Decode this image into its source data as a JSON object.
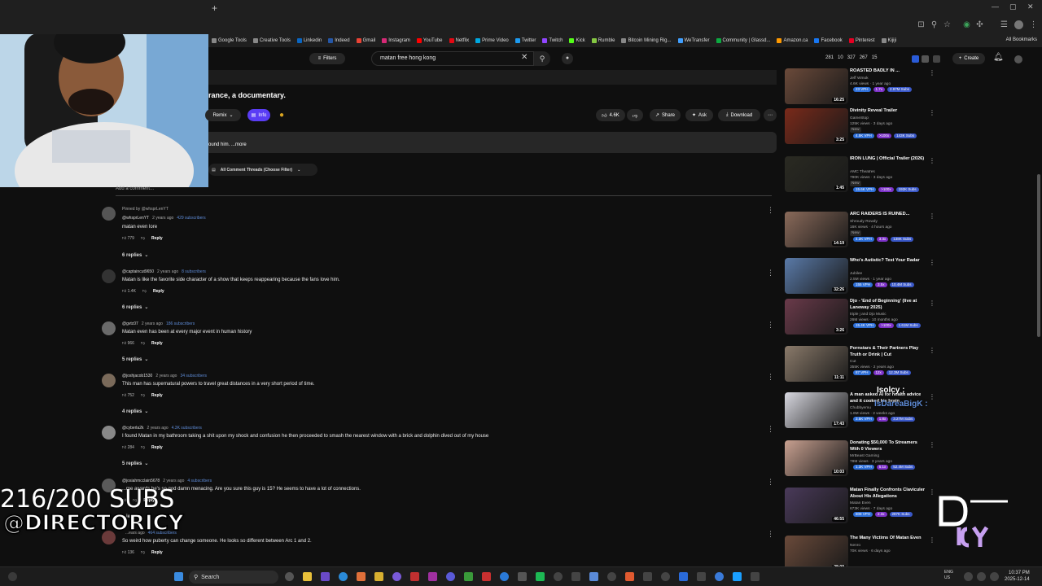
{
  "browser": {
    "new_tab": "+",
    "bookmarks": [
      {
        "label": "Google Tools",
        "color": "#888888"
      },
      {
        "label": "Creative Tools",
        "color": "#888888"
      },
      {
        "label": "Linkedin",
        "color": "#0a66c2"
      },
      {
        "label": "Indeed",
        "color": "#2557a7"
      },
      {
        "label": "Gmail",
        "color": "#ea4335"
      },
      {
        "label": "Instagram",
        "color": "#d62976"
      },
      {
        "label": "YouTube",
        "color": "#ff0000"
      },
      {
        "label": "Netflix",
        "color": "#e50914"
      },
      {
        "label": "Prime Video",
        "color": "#00a8e1"
      },
      {
        "label": "Twitter",
        "color": "#1d9bf0"
      },
      {
        "label": "Twitch",
        "color": "#9146ff"
      },
      {
        "label": "Kick",
        "color": "#53fc18"
      },
      {
        "label": "Rumble",
        "color": "#85c742"
      },
      {
        "label": "Bitcoin Mining Rig...",
        "color": "#888888"
      },
      {
        "label": "WeTransfer",
        "color": "#409fff"
      },
      {
        "label": "Community | Glassd...",
        "color": "#0caa41"
      },
      {
        "label": "Amazon.ca",
        "color": "#ff9900"
      },
      {
        "label": "Facebook",
        "color": "#1877f2"
      },
      {
        "label": "Pinterest",
        "color": "#e60023"
      },
      {
        "label": "Kijiji",
        "color": "#888888"
      }
    ],
    "all_bookmarks": "All Bookmarks"
  },
  "header": {
    "filters_label": "Filters",
    "search_value": "matan free hong kong",
    "stats": [
      "281",
      "10",
      "327",
      "267",
      "15"
    ],
    "create_label": "Create"
  },
  "video": {
    "title": "rance, a documentary.",
    "remix_label": "Remix",
    "info_label": "Info",
    "like_count": "4.6K",
    "share_label": "Share",
    "ask_label": "Ask",
    "download_label": "Download",
    "description": "ound him. ...more"
  },
  "comments_section": {
    "sort_label": "All Comment Threads (Choose Filter)",
    "add_comment_placeholder": "Add a comment..."
  },
  "comments": [
    {
      "pinned": "Pinned by @whsprLenYT",
      "author": "@whsprLenYT",
      "time": "2 years ago",
      "subs": "429 subscribers",
      "text": "matan even lore",
      "likes": "779",
      "reply": "Reply",
      "replies": "6 replies"
    },
    {
      "author": "@captaincut9650",
      "time": "2 years ago",
      "subs": "8 subscribers",
      "text": "Matan is like the favorite side character of a show that keeps reappearing because the fans love him.",
      "likes": "1.4K",
      "reply": "Reply",
      "replies": "6 replies"
    },
    {
      "author": "@gvtc07",
      "time": "2 years ago",
      "subs": "186 subscribers",
      "text": "Matan even has been at every major event in human history",
      "likes": "966",
      "reply": "Reply",
      "replies": "5 replies"
    },
    {
      "author": "@joshjacob1530",
      "time": "2 years ago",
      "subs": "34 subscribers",
      "text": "This man has supernatural powers to travel great distances in a very short period of time.",
      "likes": "752",
      "reply": "Reply",
      "replies": "4 replies"
    },
    {
      "author": "@cyberla2k",
      "time": "2 years ago",
      "subs": "4.3K subscribers",
      "text": "I found Matan in my bathroom taking a shit upon my shock and confusion he then proceeded to smash the nearest window with a brick and dolphin dived out of my house",
      "likes": "284",
      "reply": "Reply",
      "replies": "5 replies"
    },
    {
      "author": "@josiahmcclain5678",
      "time": "2 years ago",
      "subs": "4 subscribers",
      "text": "...me awards he's so god damn menacing. Are you sure this guy is 15? He seems to have a lot of connections.",
      "likes": "",
      "reply": "Reply",
      "replies": "...ies"
    },
    {
      "author": "",
      "time": "...ears ago",
      "subs": "464 subscribers",
      "text": "So weird how puberty can change someone. He looks so different between Arc 1 and 2.",
      "likes": "136",
      "reply": "Reply",
      "replies": ""
    }
  ],
  "sidebar": [
    {
      "title": "ROASTED BADLY IN ...",
      "channel": "Jeff Wmok",
      "views": "4.6K views · 1 year ago",
      "duration": "16:25",
      "tags": [
        "23 VPH",
        "1.7x",
        "2.97M Subs"
      ],
      "thumb": "#6b4a3a"
    },
    {
      "title": "Divinity Reveal Trailer",
      "channel": "GameStop",
      "views": "125K views · 3 days ago",
      "new": "New",
      "duration": "3:25",
      "tags": [
        "4.5K VPH",
        ">100x",
        "143K Subs"
      ],
      "thumb": "#7a2a1a"
    },
    {
      "title": "IRON LUNG | Official Trailer (2026)",
      "channel": "AMC Theatres",
      "views": "790K views · 3 days ago",
      "new": "New",
      "duration": "1:45",
      "tags": [
        "15.6K VPH",
        ">100x",
        "192K Subs"
      ],
      "thumb": "#2a2a22"
    },
    {
      "title": "ARC RAIDERS IS RUINED...",
      "channel": "Shroudy Rowdy",
      "views": "16K views · 4 hours ago",
      "new": "New",
      "duration": "14:19",
      "tags": [
        "4.2K VPH",
        "3.3x",
        "138K Subs"
      ],
      "thumb": "#8a6a5a"
    },
    {
      "title": "Who's Autistic? Test Your Radar",
      "channel": "Jubilee",
      "views": "2.5M views · 1 year ago",
      "duration": "32:26",
      "tags": [
        "155 VPH",
        "3.5x",
        "10.4M Subs"
      ],
      "thumb": "#5a7aa8"
    },
    {
      "title": "Djo - 'End of Beginning' (live at Laneway 2025)",
      "channel": "triple j and Djo Music",
      "views": "26M views · 10 months ago",
      "duration": "3:26",
      "tags": [
        "15.4K VPH",
        ">100x",
        "1.61M Subs"
      ],
      "thumb": "#6a3a4a"
    },
    {
      "title": "Pornstars & Their Partners Play Truth or Drink | Cut",
      "channel": "Cut",
      "views": "355K views · 2 years ago",
      "duration": "11:11",
      "tags": [
        "87 VPH",
        "12x",
        "12.3M Subs"
      ],
      "thumb": "#8a7a6a"
    },
    {
      "title": "A man asked AI for health advice and it cooked his brain",
      "channel": "Chubbyemu",
      "views": "1.6M views · 2 weeks ago",
      "duration": "17:43",
      "tags": [
        "3.5K VPH",
        "1.8x",
        "3.27M Subs"
      ],
      "thumb": "#d8d8e0"
    },
    {
      "title": "Donating $50,000 To Streamers With 0 Viewers",
      "channel": "MrBeast Gaming",
      "views": "78M views · 3 years ago",
      "duration": "10:03",
      "tags": [
        "1.3K VPH",
        "5.1x",
        "52.4M Subs"
      ],
      "thumb": "#c8a090"
    },
    {
      "title": "Matan Finally Confronts Claviculer About His Allegations",
      "channel": "Matan Even",
      "views": "673K views · 7 days ago",
      "duration": "46:55",
      "tags": [
        "809 VPH",
        "2.3x",
        "287K Subs"
      ],
      "thumb": "#4a3a5a"
    },
    {
      "title": "The Many Victims Of Matan Even",
      "channel": "Nenro",
      "views": "70K views · 6 days ago",
      "duration": "28:09",
      "tags": [],
      "thumb": "#6a4a3a"
    }
  ],
  "overlay": {
    "subs_counter": "216/200 SUBS",
    "handle": "@DIRECTORICY",
    "chat_name_1": "Isolcy :",
    "chat_name_2": "IsDareaBigK :"
  },
  "taskbar": {
    "search_label": "Search",
    "lang_1": "ENG",
    "lang_2": "US",
    "time": "10:37 PM",
    "date": "2025-12-14"
  },
  "colors": {
    "background": "#0f0f0f",
    "accent_purple": "#5a3df5",
    "subs_link": "#5e8bd6"
  }
}
